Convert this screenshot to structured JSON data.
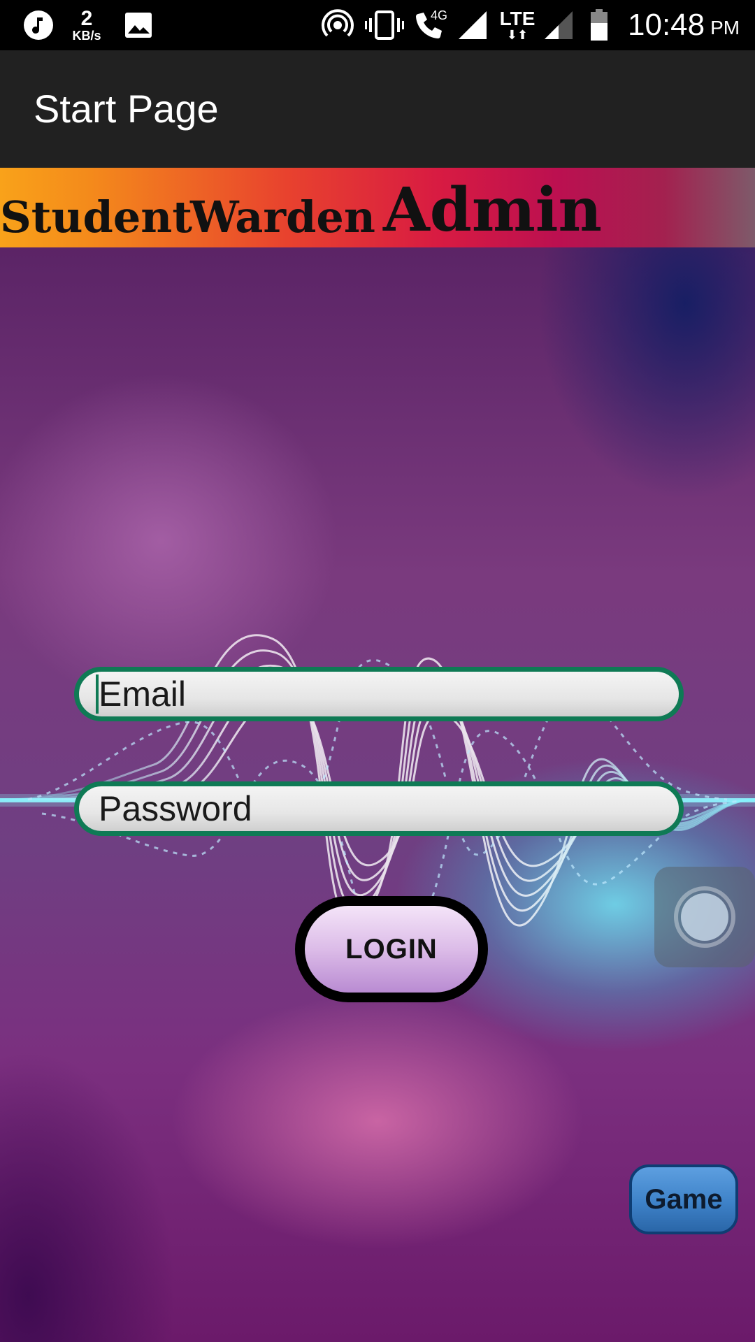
{
  "status_bar": {
    "data_rate_value": "2",
    "data_rate_unit": "KB/s",
    "network_label": "4G",
    "lte_label": "LTE",
    "time": "10:48",
    "ampm": "PM",
    "icons": [
      "music-icon",
      "image-icon",
      "hotspot-icon",
      "vibrate-icon",
      "wifi-call-icon",
      "signal-icon",
      "lte-icon",
      "signal-weak-icon",
      "battery-icon"
    ]
  },
  "app_bar": {
    "title": "Start Page"
  },
  "tabs": {
    "student": "Student",
    "warden": "Warden",
    "admin": "Admin"
  },
  "form": {
    "email_placeholder": "Email",
    "password_placeholder": "Password",
    "login_label": "LOGIN"
  },
  "game_button": {
    "label": "Game"
  },
  "colors": {
    "field_border": "#0f7a55",
    "login_fill": "#dcbce8",
    "game_fill": "#3e82c8",
    "app_bar": "#212121"
  }
}
